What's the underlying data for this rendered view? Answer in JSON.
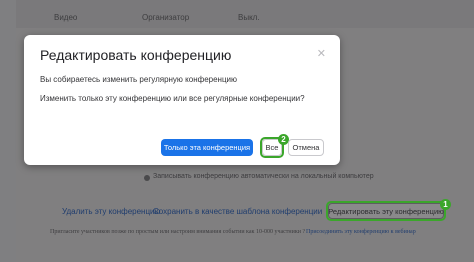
{
  "background": {
    "header": {
      "col_video": "Видео",
      "col_organizer": "Организатор",
      "col_off": "Выкл."
    },
    "record_option": "Записывать конференцию автоматически на локальный компьютер",
    "actions": {
      "delete": "Удалить эту конференцию",
      "save_template": "Сохранить в качестве шаблона конференции",
      "edit": "Редактировать эту конференцию"
    },
    "footer": {
      "text": "Пригласите участников позже по простым или настроим внимания событии как 10-000 участники ?",
      "link": "Присоединить эту конференцию к вебинар"
    },
    "badge_edit": "1"
  },
  "modal": {
    "title": "Редактировать конференцию",
    "close_icon": "close-icon",
    "line1": "Вы собираетесь изменить регулярную конференцию",
    "line2": "Изменить только эту конференцию или все регулярные конференции?",
    "buttons": {
      "only_this": "Только эта конференция",
      "all": "Все",
      "cancel": "Отмена"
    },
    "badge_all": "2"
  },
  "colors": {
    "accent": "#1a73e8",
    "highlight": "#3ba62b"
  }
}
